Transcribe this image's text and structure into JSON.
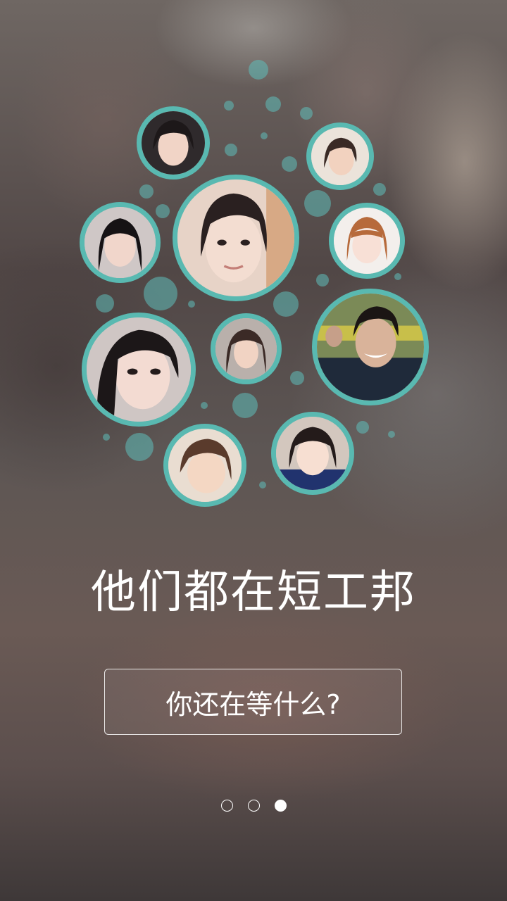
{
  "headline": "他们都在短工邦",
  "cta_label": "你还在等什么?",
  "pager": {
    "pages": 3,
    "active_index": 2
  },
  "colors": {
    "accent": "#59b9b1",
    "text": "#ffffff"
  }
}
